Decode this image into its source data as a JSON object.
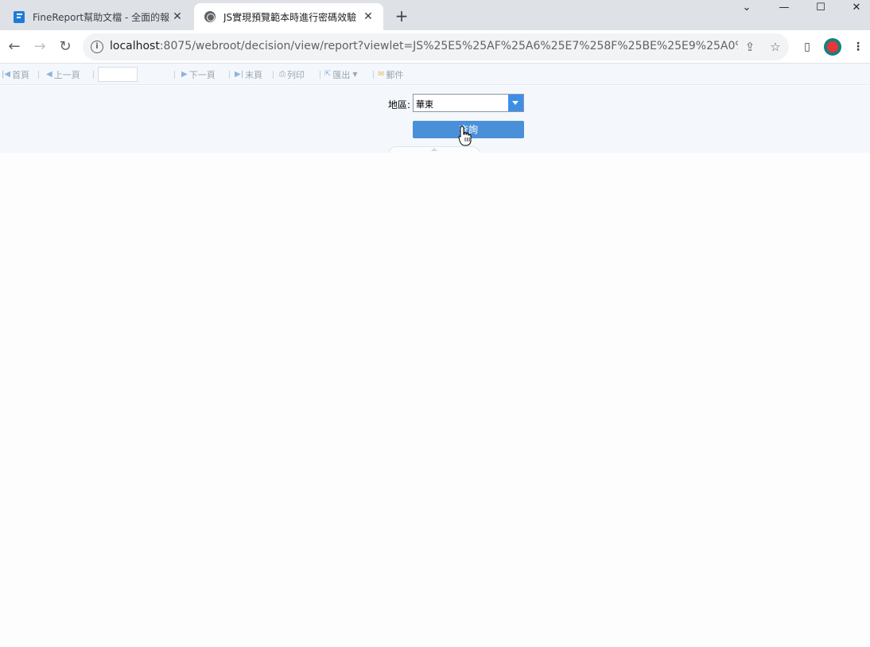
{
  "browser": {
    "tabs": [
      {
        "title": "FineReport幫助文檔 - 全面的報表",
        "close": "✕"
      },
      {
        "title": "JS實現預覽範本時進行密碼效驗",
        "close": "✕"
      }
    ],
    "new_tab": "+",
    "window_controls": {
      "dropdown": "⌄",
      "minimize": "—",
      "maximize": "☐",
      "close": "✕"
    },
    "url_host": "localhost",
    "url_rest": ":8075/webroot/decision/view/report?viewlet=JS%25E5%25AF%25A6%25E7%258F%25BE%25E9%25A0%2..."
  },
  "report_toolbar": {
    "first_page": "首頁",
    "prev_page": "上一頁",
    "next_page": "下一頁",
    "last_page": "末頁",
    "print": "列印",
    "export": "匯出",
    "email": "郵件"
  },
  "params": {
    "region_label": "地區:",
    "region_value": "華東",
    "query_button": "查詢"
  },
  "colors": {
    "accent": "#4a90d9",
    "combo_arrow": "#3d8fe6",
    "toolbar_bg": "#f4f8fd"
  }
}
